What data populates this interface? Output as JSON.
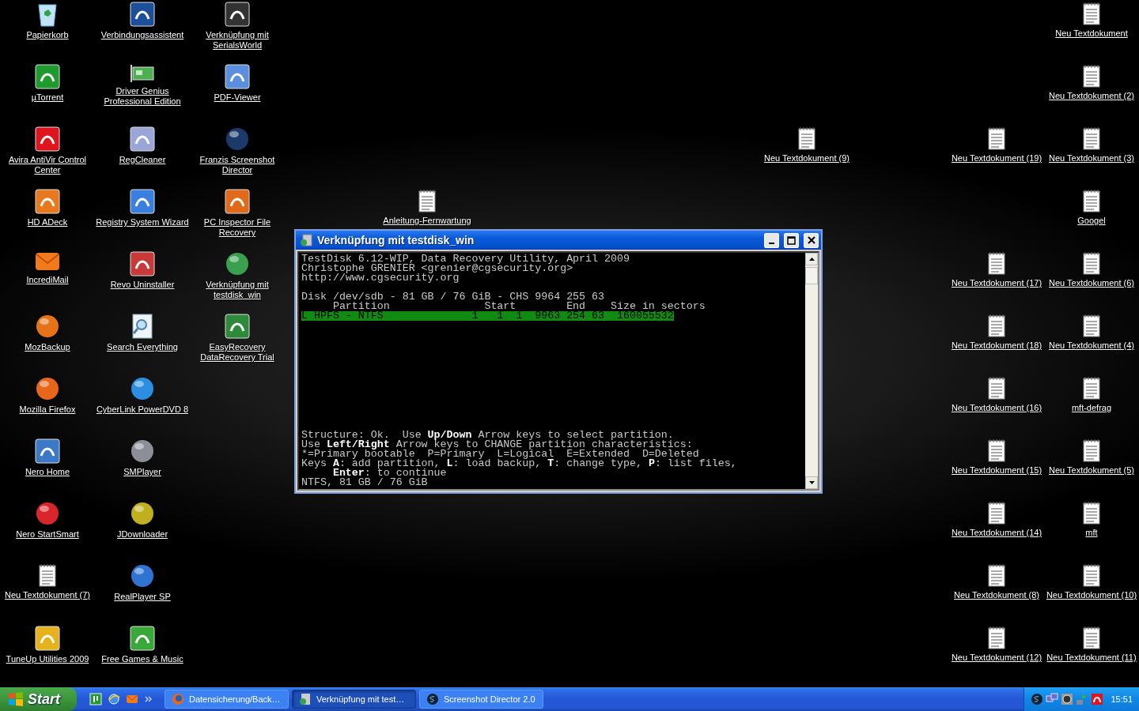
{
  "desktop": {
    "left_columns": [
      [
        {
          "label": "Papierkorb"
        },
        {
          "label": "µTorrent"
        },
        {
          "label": "Avira AntiVir Control Center"
        },
        {
          "label": "HD ADeck"
        },
        {
          "label": "IncrediMail"
        },
        {
          "label": "MozBackup"
        },
        {
          "label": "Mozilla Firefox"
        },
        {
          "label": "Nero Home"
        },
        {
          "label": "Nero StartSmart"
        },
        {
          "label": "Neu Textdokument (7)"
        },
        {
          "label": "TuneUp Utilities 2009"
        }
      ],
      [
        {
          "label": "Verbindungsassistent"
        },
        {
          "label": "Driver Genius Professional Edition"
        },
        {
          "label": "RegCleaner"
        },
        {
          "label": "Registry System Wizard"
        },
        {
          "label": "Revo Uninstaller"
        },
        {
          "label": "Search Everything"
        },
        {
          "label": "CyberLink PowerDVD 8"
        },
        {
          "label": "SMPlayer"
        },
        {
          "label": "JDownloader"
        },
        {
          "label": "RealPlayer SP"
        },
        {
          "label": "Free Games & Music"
        }
      ],
      [
        {
          "label": "Verknüpfung mit SerialsWorld"
        },
        {
          "label": "PDF-Viewer"
        },
        {
          "label": "Franzis Screenshot Director"
        },
        {
          "label": "PC Inspector File Recovery"
        },
        {
          "label": "Verknüpfung mit testdisk_win"
        },
        {
          "label": "EasyRecovery DataRecovery Trial"
        }
      ]
    ],
    "scattered": [
      {
        "label": "Anleitung-Fernwartung"
      },
      {
        "label": "Neu Textdokument (9)"
      }
    ],
    "right_columns": [
      [
        {
          "label": "Neu Textdokument (19)"
        },
        {
          "label": "Neu Textdokument (17)"
        },
        {
          "label": "Neu Textdokument (18)"
        },
        {
          "label": "Neu Textdokument (16)"
        },
        {
          "label": "Neu Textdokument (15)"
        },
        {
          "label": "Neu Textdokument (14)"
        },
        {
          "label": "Neu Textdokument (8)"
        },
        {
          "label": "Neu Textdokument (12)"
        }
      ],
      [
        {
          "label": "Neu Textdokument"
        },
        {
          "label": "Neu Textdokument (2)"
        },
        {
          "label": "Neu Textdokument (3)"
        },
        {
          "label": "Googel"
        },
        {
          "label": "Neu Textdokument (6)"
        },
        {
          "label": "Neu Textdokument (4)"
        },
        {
          "label": "mft-defrag"
        },
        {
          "label": "Neu Textdokument (5)"
        },
        {
          "label": "mft"
        },
        {
          "label": "Neu Textdokument (10)"
        },
        {
          "label": "Neu Textdokument (11)"
        }
      ]
    ]
  },
  "window": {
    "title": "Verknüpfung mit testdisk_win",
    "console": {
      "header_lines": [
        "TestDisk 6.12-WIP, Data Recovery Utility, April 2009",
        "Christophe GRENIER <grenier@cgsecurity.org>",
        "http://www.cgsecurity.org"
      ],
      "disk_line": "Disk /dev/sdb - 81 GB / 76 GiB - CHS 9964 255 63",
      "partition_table": {
        "header": "     Partition               Start        End    Size in sectors",
        "rows": [
          {
            "text": "L HPFS - NTFS              1   1  1  9963 254 63  160055532",
            "selected": true
          }
        ]
      },
      "footer_lines": [
        "Structure: Ok.  Use **Up/Down** Arrow keys to select partition.",
        "Use **Left/Right** Arrow keys to CHANGE partition characteristics:",
        "*=Primary bootable  P=Primary  L=Logical  E=Extended  D=Deleted",
        "Keys **A**: add partition, **L**: load backup, **T**: change type, **P**: list files,",
        "     **Enter**: to continue",
        "NTFS, 81 GB / 76 GiB"
      ]
    }
  },
  "taskbar": {
    "start_label": "Start",
    "task_buttons": [
      {
        "label": "Datensicherung/Back…",
        "selected": false
      },
      {
        "label": "Verknüpfung mit test…",
        "selected": true
      },
      {
        "label": "Screenshot Director 2.0",
        "selected": false
      }
    ],
    "clock": "15:51"
  }
}
